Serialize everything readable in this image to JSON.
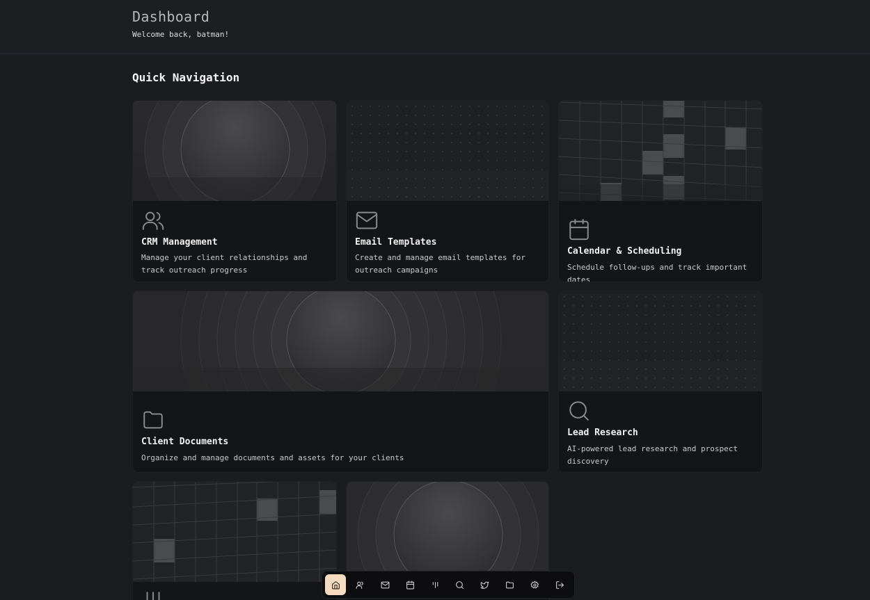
{
  "header": {
    "title": "Dashboard",
    "subtitle": "Welcome back, batman!"
  },
  "section": {
    "title": "Quick Navigation"
  },
  "cards": [
    {
      "title": "CRM Management",
      "description": "Manage your client relationships and track outreach progress",
      "icon": "users-icon"
    },
    {
      "title": "Email Templates",
      "description": "Create and manage email templates for outreach campaigns",
      "icon": "mail-icon"
    },
    {
      "title": "Calendar & Scheduling",
      "description": "Schedule follow-ups and track important dates",
      "icon": "calendar-icon"
    },
    {
      "title": "Client Documents",
      "description": "Organize and manage documents and assets for your clients",
      "icon": "folder-icon"
    },
    {
      "title": "Lead Research",
      "description": "AI-powered lead research and prospect discovery",
      "icon": "search-icon"
    }
  ],
  "dock": {
    "items": [
      "home-icon",
      "users-icon",
      "mail-icon",
      "calendar-icon",
      "columns-icon",
      "search-icon",
      "twitter-icon",
      "folder-icon",
      "gear-icon",
      "logout-icon"
    ],
    "active": "home-icon"
  },
  "colors": {
    "background": "#1b1c1f",
    "card": "#141517",
    "accent": "#f5dcc0"
  }
}
